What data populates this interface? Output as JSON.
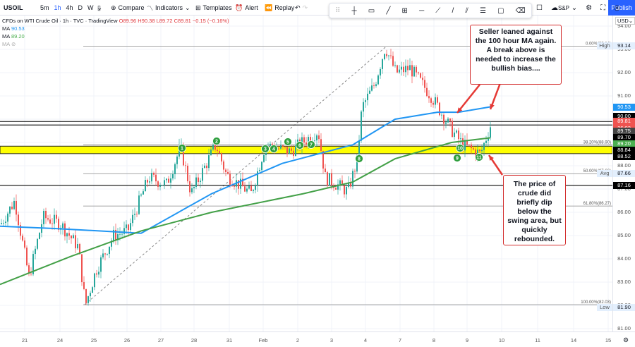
{
  "toolbar": {
    "symbol": "USOIL",
    "timeframes": [
      "5m",
      "1h",
      "4h",
      "D",
      "W"
    ],
    "active_timeframe": "1h",
    "compare": "Compare",
    "indicators": "Indicators",
    "templates": "Templates",
    "alert": "Alert",
    "replay": "Replay",
    "publish": "Publish",
    "currency": "S&P"
  },
  "legend": {
    "title": "CFDs on WTI Crude Oil · 1h · TVC · TradingView",
    "ohlc": "O89.96 H90.38 L89.72 C89.81 −0.15 (−0.16%)",
    "ma1_label": "MA",
    "ma1": "90.53",
    "ma2_label": "MA",
    "ma2": "89.20",
    "ma3_label": "MA"
  },
  "price_axis": {
    "currency": "USD",
    "ticks": [
      "94.00",
      "93.00",
      "92.00",
      "91.00",
      "90.00",
      "89.00",
      "88.00",
      "87.00",
      "86.00",
      "85.00",
      "84.00",
      "83.00",
      "82.00",
      "81.00"
    ]
  },
  "price_labels": [
    {
      "text": "93.14",
      "value": 93.14,
      "bg": "#e3effd",
      "fg": "#131722",
      "tag": "High"
    },
    {
      "text": "90.53",
      "value": 90.53,
      "bg": "#2196f3",
      "fg": "#fff"
    },
    {
      "text": "90.00",
      "value": 90.12,
      "bg": "#000",
      "fg": "#fff"
    },
    {
      "text": "89.81",
      "value": 89.92,
      "bg": "#ef5350",
      "fg": "#fff"
    },
    {
      "text": "26:02",
      "value": 89.62,
      "bg": "#ef5350",
      "fg": "#fff"
    },
    {
      "text": "89.75",
      "value": 89.48,
      "bg": "#444",
      "fg": "#fff"
    },
    {
      "text": "89.70",
      "value": 89.2,
      "bg": "#000",
      "fg": "#fff"
    },
    {
      "text": "89.20",
      "value": 88.95,
      "bg": "#4caf50",
      "fg": "#fff"
    },
    {
      "text": "88.84",
      "value": 88.66,
      "bg": "#000",
      "fg": "#fff"
    },
    {
      "text": "88.52",
      "value": 88.38,
      "bg": "#000",
      "fg": "#fff"
    },
    {
      "text": "87.66",
      "value": 87.66,
      "bg": "#e3effd",
      "fg": "#131722",
      "tag": "Avg"
    },
    {
      "text": "87.16",
      "value": 87.16,
      "bg": "#000",
      "fg": "#fff"
    },
    {
      "text": "81.90",
      "value": 81.9,
      "bg": "#e3effd",
      "fg": "#131722",
      "tag": "Low"
    }
  ],
  "date_axis": [
    "21",
    "24",
    "25",
    "26",
    "27",
    "28",
    "31",
    "Feb",
    "2",
    "3",
    "4",
    "7",
    "8",
    "9",
    "10",
    "11",
    "14",
    "15"
  ],
  "fib": [
    {
      "label": "0.00%(93.14)",
      "value": 93.14
    },
    {
      "label": "38.20%(88.90)",
      "value": 88.9
    },
    {
      "label": "50.00%(87.66)",
      "value": 87.66
    },
    {
      "label": "61.80%(86.27)",
      "value": 86.27
    },
    {
      "label": "100.00%(82.03)",
      "value": 82.03
    }
  ],
  "levels": [
    89.9,
    89.75,
    87.16
  ],
  "swing_zone": [
    88.52,
    88.84
  ],
  "markers": [
    "1",
    "2",
    "3",
    "4",
    "5",
    "6",
    "7",
    "8",
    "9",
    "10",
    "11"
  ],
  "annotations": {
    "top": "Seller leaned against the 100 hour MA again.  A break above is needed to increase the bullish bias....",
    "bottom": "The price of crude did briefly dip below the swing area, but quickly rebounded."
  },
  "chart_data": {
    "type": "line",
    "title": "USOIL 1h",
    "ylim": [
      81,
      94
    ],
    "price_path": [
      [
        0,
        85.5
      ],
      [
        20,
        86.5
      ],
      [
        40,
        83.2
      ],
      [
        60,
        85.8
      ],
      [
        85,
        85.5
      ],
      [
        110,
        84.5
      ],
      [
        120,
        82
      ],
      [
        135,
        83.5
      ],
      [
        160,
        85
      ],
      [
        180,
        85.2
      ],
      [
        210,
        87.5
      ],
      [
        235,
        87.2
      ],
      [
        255,
        88.8
      ],
      [
        270,
        86.8
      ],
      [
        305,
        88.9
      ],
      [
        320,
        87.6
      ],
      [
        355,
        86.8
      ],
      [
        375,
        88.9
      ],
      [
        410,
        88.6
      ],
      [
        450,
        89.5
      ],
      [
        460,
        87.5
      ],
      [
        492,
        86.9
      ],
      [
        505,
        88.2
      ],
      [
        512,
        90.5
      ],
      [
        530,
        91.5
      ],
      [
        545,
        93.1
      ],
      [
        560,
        92
      ],
      [
        580,
        92.2
      ],
      [
        610,
        91
      ],
      [
        640,
        89.5
      ],
      [
        655,
        88.9
      ],
      [
        680,
        88.5
      ],
      [
        695,
        89.8
      ]
    ],
    "ma_100": [
      [
        0,
        85.4
      ],
      [
        80,
        85.3
      ],
      [
        200,
        85.1
      ],
      [
        300,
        86.8
      ],
      [
        400,
        88.1
      ],
      [
        500,
        88.9
      ],
      [
        560,
        90
      ],
      [
        620,
        90.3
      ],
      [
        650,
        90.3
      ],
      [
        695,
        90.53
      ]
    ],
    "ma_200": [
      [
        0,
        82.9
      ],
      [
        100,
        84.1
      ],
      [
        200,
        85.2
      ],
      [
        300,
        86
      ],
      [
        430,
        86.8
      ],
      [
        500,
        87.3
      ],
      [
        560,
        88.3
      ],
      [
        640,
        89
      ],
      [
        695,
        89.2
      ]
    ]
  }
}
